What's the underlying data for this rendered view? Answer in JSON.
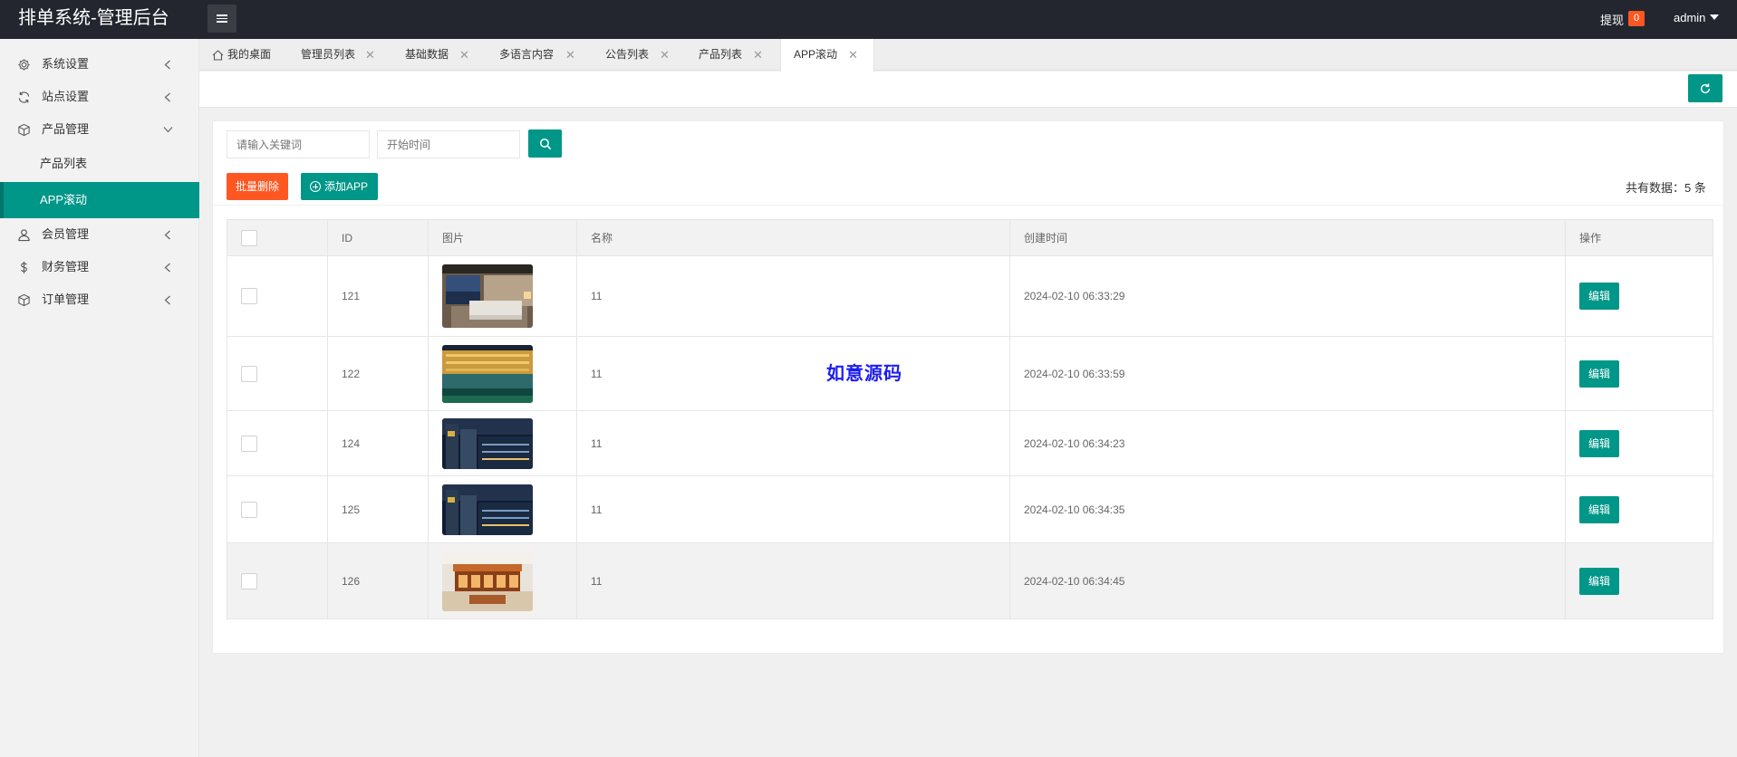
{
  "header": {
    "title": "排单系统-管理后台",
    "withdraw_label": "提现",
    "withdraw_count": "0",
    "user": "admin"
  },
  "sidebar": {
    "items": [
      {
        "label": "系统设置",
        "icon": "gear-icon"
      },
      {
        "label": "站点设置",
        "icon": "sync-icon"
      },
      {
        "label": "产品管理",
        "icon": "cube-icon"
      },
      {
        "label": "产品列表"
      },
      {
        "label": "APP滚动"
      },
      {
        "label": "会员管理",
        "icon": "user-icon"
      },
      {
        "label": "财务管理",
        "icon": "dollar-icon"
      },
      {
        "label": "订单管理",
        "icon": "cube-icon"
      }
    ]
  },
  "tabs": [
    {
      "label": "我的桌面"
    },
    {
      "label": "管理员列表"
    },
    {
      "label": "基础数据"
    },
    {
      "label": "多语言内容"
    },
    {
      "label": "公告列表"
    },
    {
      "label": "产品列表"
    },
    {
      "label": "APP滚动"
    }
  ],
  "search": {
    "keyword_placeholder": "请输入关键词",
    "start_time_placeholder": "开始时间"
  },
  "actions": {
    "batch_delete": "批量删除",
    "add_app": "添加APP",
    "total": "共有数据：5 条"
  },
  "table": {
    "columns": [
      "ID",
      "图片",
      "名称",
      "创建时间",
      "操作"
    ],
    "edit_label": "编辑",
    "rows": [
      {
        "id": "121",
        "name": "11",
        "created": "2024-02-10 06:33:29",
        "image": "hotel-room"
      },
      {
        "id": "122",
        "name": "11",
        "created": "2024-02-10 06:33:59",
        "image": "hotel-pool"
      },
      {
        "id": "124",
        "name": "11",
        "created": "2024-02-10 06:34:23",
        "image": "city-night"
      },
      {
        "id": "125",
        "name": "11",
        "created": "2024-02-10 06:34:35",
        "image": "city-night"
      },
      {
        "id": "126",
        "name": "11",
        "created": "2024-02-10 06:34:45",
        "image": "hotel-lobby"
      }
    ]
  },
  "watermark": "如意源码",
  "colors": {
    "header_bg": "#23262e",
    "accent": "#009688",
    "danger": "#ff5722"
  }
}
